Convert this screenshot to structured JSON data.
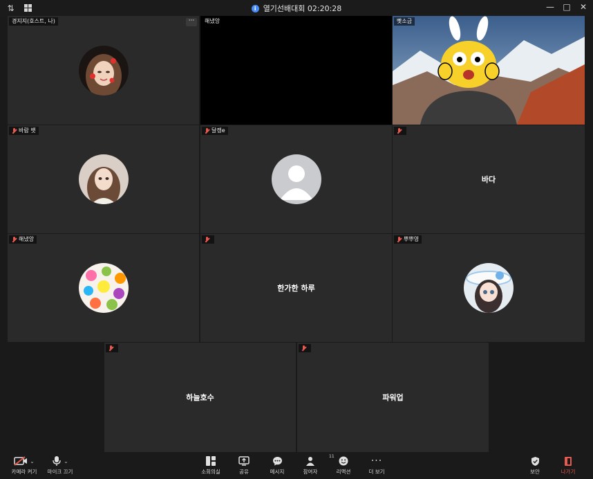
{
  "window": {
    "title": "열기선배대회 02:20:28"
  },
  "tiles": [
    {
      "name": "경지지(호스트, 나)"
    },
    {
      "name": "해냈앙"
    },
    {
      "name": "빳소금"
    },
    {
      "name": "바람 뱃"
    },
    {
      "name": "달캥e"
    },
    {
      "name": "",
      "display_name": "바다"
    },
    {
      "name": "해냈앙"
    },
    {
      "name": "",
      "display_name": "한가한 하루"
    },
    {
      "name": "뿌뿌영"
    },
    {
      "name": "",
      "display_name": "하늘호수"
    },
    {
      "name": "",
      "display_name": "파워업"
    }
  ],
  "toolbar": {
    "camera": "카메라 켜기",
    "mic": "마이크 끄기",
    "breakout": "소회의실",
    "share": "공유",
    "chat": "메시지",
    "participants": "참여자",
    "participants_count": "11",
    "reactions": "리액션",
    "more": "더 보기",
    "security": "보안",
    "leave": "나가기"
  },
  "colors": {
    "leave": "#e8594f",
    "info": "#4a8cf6"
  }
}
